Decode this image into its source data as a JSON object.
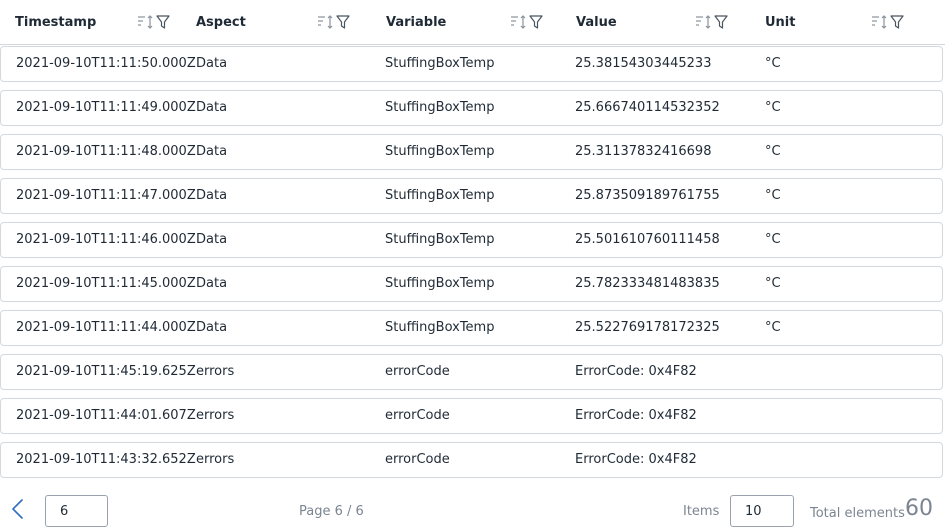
{
  "columns": [
    {
      "label": "Timestamp"
    },
    {
      "label": "Aspect"
    },
    {
      "label": "Variable"
    },
    {
      "label": "Value"
    },
    {
      "label": "Unit"
    }
  ],
  "rows": [
    {
      "timestamp": "2021-09-10T11:11:50.000Z",
      "aspect": "Data",
      "variable": "StuffingBoxTemp",
      "value": "25.38154303445233",
      "unit": "°C"
    },
    {
      "timestamp": "2021-09-10T11:11:49.000Z",
      "aspect": "Data",
      "variable": "StuffingBoxTemp",
      "value": "25.666740114532352",
      "unit": "°C"
    },
    {
      "timestamp": "2021-09-10T11:11:48.000Z",
      "aspect": "Data",
      "variable": "StuffingBoxTemp",
      "value": "25.31137832416698",
      "unit": "°C"
    },
    {
      "timestamp": "2021-09-10T11:11:47.000Z",
      "aspect": "Data",
      "variable": "StuffingBoxTemp",
      "value": "25.873509189761755",
      "unit": "°C"
    },
    {
      "timestamp": "2021-09-10T11:11:46.000Z",
      "aspect": "Data",
      "variable": "StuffingBoxTemp",
      "value": "25.501610760111458",
      "unit": "°C"
    },
    {
      "timestamp": "2021-09-10T11:11:45.000Z",
      "aspect": "Data",
      "variable": "StuffingBoxTemp",
      "value": "25.782333481483835",
      "unit": "°C"
    },
    {
      "timestamp": "2021-09-10T11:11:44.000Z",
      "aspect": "Data",
      "variable": "StuffingBoxTemp",
      "value": "25.522769178172325",
      "unit": "°C"
    },
    {
      "timestamp": "2021-09-10T11:45:19.625Z",
      "aspect": "errors",
      "variable": "errorCode",
      "value": "ErrorCode: 0x4F82",
      "unit": ""
    },
    {
      "timestamp": "2021-09-10T11:44:01.607Z",
      "aspect": "errors",
      "variable": "errorCode",
      "value": "ErrorCode: 0x4F82",
      "unit": ""
    },
    {
      "timestamp": "2021-09-10T11:43:32.652Z",
      "aspect": "errors",
      "variable": "errorCode",
      "value": "ErrorCode: 0x4F82",
      "unit": ""
    }
  ],
  "pagination": {
    "page_input_value": "6",
    "page_label": "Page 6 / 6",
    "items_label": "Items",
    "items_value": "10",
    "total_label": "Total elements",
    "total_value": "60"
  },
  "icons": {
    "sort": "sort-icon",
    "filter": "filter-icon",
    "prev": "chevron-left-icon"
  },
  "colors": {
    "text": "#1f2a36",
    "muted": "#7b8591",
    "border": "#d3d8de",
    "accent": "#2f6fbf"
  }
}
